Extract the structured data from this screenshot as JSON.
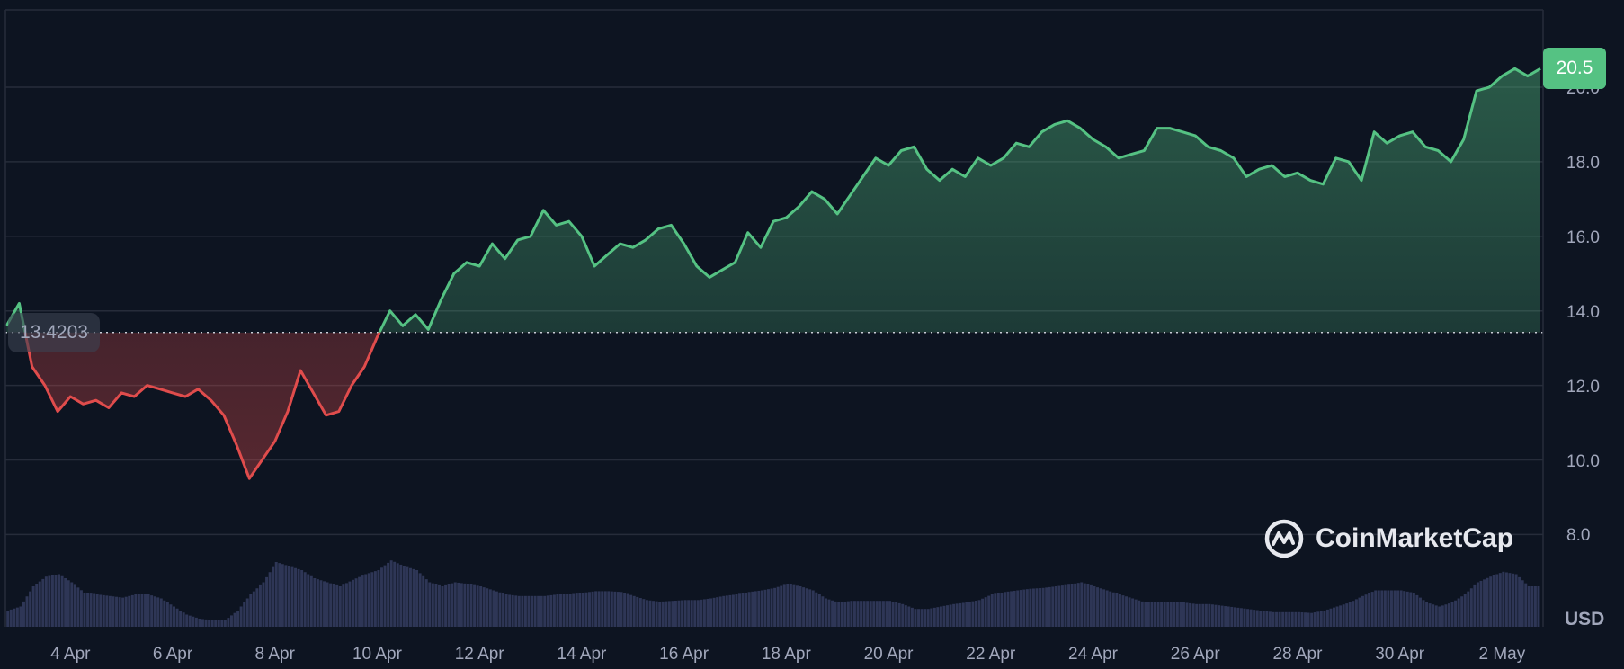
{
  "chart_data": {
    "type": "line",
    "title": "",
    "currency_label": "USD",
    "start_date": "3 Apr (2.75)",
    "step_days": 0.25,
    "baseline": 13.4203,
    "baseline_label": "13.4203",
    "current_value": 20.5,
    "current_label": "20.5",
    "ylim": [
      7.0,
      21.5
    ],
    "yticks": [
      {
        "value": 8,
        "label": "8.0"
      },
      {
        "value": 10,
        "label": "10.0"
      },
      {
        "value": 12,
        "label": "12.0"
      },
      {
        "value": 14,
        "label": "14.0"
      },
      {
        "value": 16,
        "label": "16.0"
      },
      {
        "value": 18,
        "label": "18.0"
      },
      {
        "value": 20,
        "label": "20.0"
      }
    ],
    "xticks": [
      {
        "offset": 1.25,
        "label": "4 Apr"
      },
      {
        "offset": 3.25,
        "label": "6 Apr"
      },
      {
        "offset": 5.25,
        "label": "8 Apr"
      },
      {
        "offset": 7.25,
        "label": "10 Apr"
      },
      {
        "offset": 9.25,
        "label": "12 Apr"
      },
      {
        "offset": 11.25,
        "label": "14 Apr"
      },
      {
        "offset": 13.25,
        "label": "16 Apr"
      },
      {
        "offset": 15.25,
        "label": "18 Apr"
      },
      {
        "offset": 17.25,
        "label": "20 Apr"
      },
      {
        "offset": 19.25,
        "label": "22 Apr"
      },
      {
        "offset": 21.25,
        "label": "24 Apr"
      },
      {
        "offset": 23.25,
        "label": "26 Apr"
      },
      {
        "offset": 25.25,
        "label": "28 Apr"
      },
      {
        "offset": 27.25,
        "label": "30 Apr"
      },
      {
        "offset": 29.25,
        "label": "2 May"
      }
    ],
    "price": [
      13.6,
      14.2,
      12.5,
      12.0,
      11.3,
      11.7,
      11.5,
      11.6,
      11.4,
      11.8,
      11.7,
      12.0,
      11.9,
      11.8,
      11.7,
      11.9,
      11.6,
      11.2,
      10.4,
      9.5,
      10.0,
      10.5,
      11.3,
      12.4,
      11.8,
      11.2,
      11.3,
      12.0,
      12.5,
      13.3,
      14.0,
      13.6,
      13.9,
      13.5,
      14.3,
      15.0,
      15.3,
      15.2,
      15.8,
      15.4,
      15.9,
      16.0,
      16.7,
      16.3,
      16.4,
      16.0,
      15.2,
      15.5,
      15.8,
      15.7,
      15.9,
      16.2,
      16.3,
      15.8,
      15.2,
      14.9,
      15.1,
      15.3,
      16.1,
      15.7,
      16.4,
      16.5,
      16.8,
      17.2,
      17.0,
      16.6,
      17.1,
      17.6,
      18.1,
      17.9,
      18.3,
      18.4,
      17.8,
      17.5,
      17.8,
      17.6,
      18.1,
      17.9,
      18.1,
      18.5,
      18.4,
      18.8,
      19.0,
      19.1,
      18.9,
      18.6,
      18.4,
      18.1,
      18.2,
      18.3,
      18.9,
      18.9,
      18.8,
      18.7,
      18.4,
      18.3,
      18.1,
      17.6,
      17.8,
      17.9,
      17.6,
      17.7,
      17.5,
      17.4,
      18.1,
      18.0,
      17.5,
      18.8,
      18.5,
      18.7,
      18.8,
      18.4,
      18.3,
      18.0,
      18.6,
      19.9,
      20.0,
      20.3,
      20.5,
      20.3,
      20.5
    ],
    "volume_relative": [
      20,
      25,
      50,
      62,
      65,
      55,
      42,
      40,
      38,
      36,
      40,
      40,
      35,
      25,
      15,
      10,
      8,
      8,
      20,
      40,
      55,
      80,
      75,
      70,
      60,
      55,
      50,
      58,
      65,
      70,
      82,
      75,
      70,
      55,
      50,
      55,
      53,
      50,
      45,
      40,
      38,
      38,
      38,
      40,
      40,
      42,
      44,
      44,
      43,
      38,
      33,
      31,
      32,
      33,
      33,
      35,
      38,
      40,
      43,
      45,
      48,
      53,
      50,
      45,
      35,
      30,
      32,
      32,
      32,
      32,
      28,
      22,
      22,
      25,
      28,
      30,
      33,
      40,
      43,
      45,
      47,
      48,
      50,
      52,
      55,
      50,
      45,
      40,
      35,
      30,
      30,
      30,
      30,
      28,
      28,
      26,
      24,
      22,
      20,
      18,
      18,
      18,
      17,
      20,
      25,
      30,
      38,
      45,
      45,
      45,
      42,
      30,
      25,
      30,
      40,
      55,
      62,
      68,
      65,
      50,
      50
    ],
    "colors": {
      "up": "#55c283",
      "down": "#e04c4c",
      "volume": "#2e3656",
      "grid": "#262c3a"
    }
  },
  "watermark": {
    "text": "CoinMarketCap"
  }
}
